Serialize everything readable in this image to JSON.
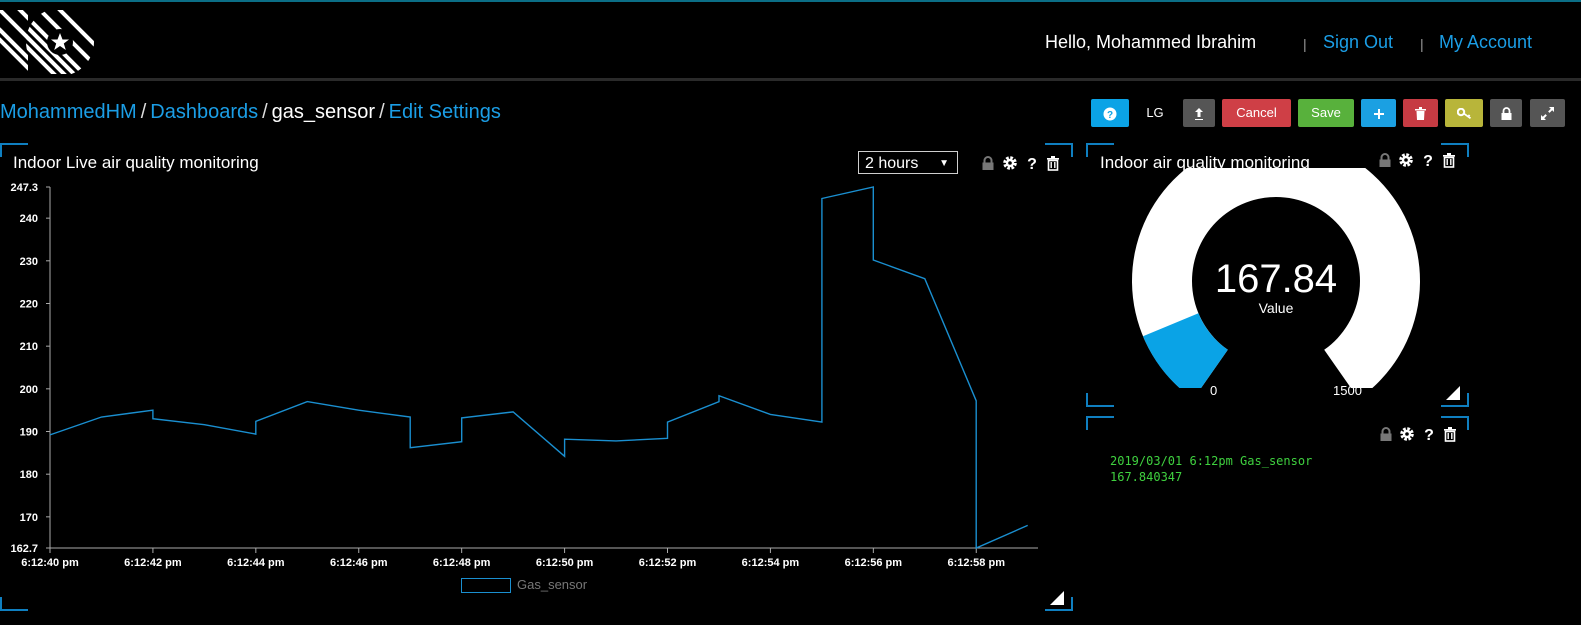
{
  "header": {
    "greeting": "Hello, Mohammed Ibrahim",
    "sign_out": "Sign Out",
    "my_account": "My Account",
    "separator": "|"
  },
  "breadcrumb": {
    "user": "MohammedHM",
    "dashboards": "Dashboards",
    "current": "gas_sensor",
    "edit": "Edit Settings",
    "slash": "/"
  },
  "toolbar": {
    "help_icon": "question-icon",
    "lg_label": "LG",
    "share_icon": "share-icon",
    "cancel_label": "Cancel",
    "save_label": "Save",
    "add_icon": "plus-icon",
    "delete_icon": "trash-icon",
    "key_icon": "key-icon",
    "lock_icon": "lock-icon",
    "expand_icon": "expand-icon",
    "colors": {
      "help": "#0ba3e6",
      "share": "#555555",
      "cancel": "#cf3f46",
      "save": "#58b13c",
      "add": "#1ba0e2",
      "delete": "#c63b43",
      "key": "#b8b53a",
      "lock": "#555555",
      "expand": "#555555"
    }
  },
  "line_panel": {
    "title": "Indoor Live air quality monitoring",
    "range_select": "2 hours",
    "controls": [
      "lock-icon",
      "gear-icon",
      "question-icon",
      "trash-icon"
    ]
  },
  "gauge_panel": {
    "title": "Indoor air quality monitoring",
    "value": "167.84",
    "value_label": "Value",
    "min": "0",
    "max": "1500",
    "level": 167.84,
    "colors": {
      "fill": "#0aa3e6",
      "track": "#ffffff"
    }
  },
  "log_panel": {
    "line1": "2019/03/01 6:12pm  Gas_sensor",
    "line2": "167.840347"
  },
  "chart_data": {
    "type": "line",
    "title": "",
    "xlabel": "",
    "ylabel": "",
    "ylim": [
      162.7,
      247.3
    ],
    "y_ticks": [
      "247.3",
      "240",
      "230",
      "220",
      "210",
      "200",
      "190",
      "180",
      "170",
      "162.7"
    ],
    "x_ticks": [
      "6:12:40 pm",
      "6:12:42 pm",
      "6:12:44 pm",
      "6:12:46 pm",
      "6:12:48 pm",
      "6:12:50 pm",
      "6:12:52 pm",
      "6:12:54 pm",
      "6:12:56 pm",
      "6:12:58 pm"
    ],
    "x_range": [
      "6:12:40 pm",
      "6:12:59.2 pm"
    ],
    "grid": false,
    "legend": "bottom",
    "series": [
      {
        "name": "Gas_sensor",
        "color": "#1a8fd0",
        "points": [
          {
            "x": "6:12:40.0 pm",
            "y": 189.2
          },
          {
            "x": "6:12:41.0 pm",
            "y": 193.4
          },
          {
            "x": "6:12:42.0 pm",
            "y": 195.0
          },
          {
            "x": "6:12:42.0 pm",
            "y": 193.0
          },
          {
            "x": "6:12:43.0 pm",
            "y": 191.6
          },
          {
            "x": "6:12:44.0 pm",
            "y": 189.4
          },
          {
            "x": "6:12:44.0 pm",
            "y": 192.4
          },
          {
            "x": "6:12:45.0 pm",
            "y": 197.0
          },
          {
            "x": "6:12:46.0 pm",
            "y": 195.0
          },
          {
            "x": "6:12:47.0 pm",
            "y": 193.4
          },
          {
            "x": "6:12:47.0 pm",
            "y": 186.2
          },
          {
            "x": "6:12:48.0 pm",
            "y": 187.6
          },
          {
            "x": "6:12:48.0 pm",
            "y": 193.2
          },
          {
            "x": "6:12:49.0 pm",
            "y": 194.6
          },
          {
            "x": "6:12:50.0 pm",
            "y": 184.2
          },
          {
            "x": "6:12:50.0 pm",
            "y": 188.2
          },
          {
            "x": "6:12:51.0 pm",
            "y": 187.8
          },
          {
            "x": "6:12:52.0 pm",
            "y": 188.4
          },
          {
            "x": "6:12:52.0 pm",
            "y": 192.2
          },
          {
            "x": "6:12:53.0 pm",
            "y": 197.0
          },
          {
            "x": "6:12:53.0 pm",
            "y": 198.4
          },
          {
            "x": "6:12:54.0 pm",
            "y": 194.0
          },
          {
            "x": "6:12:55.0 pm",
            "y": 192.2
          },
          {
            "x": "6:12:55.0 pm",
            "y": 244.6
          },
          {
            "x": "6:12:56.0 pm",
            "y": 247.3
          },
          {
            "x": "6:12:56.0 pm",
            "y": 230.2
          },
          {
            "x": "6:12:57.0 pm",
            "y": 225.8
          },
          {
            "x": "6:12:58.0 pm",
            "y": 197.2
          },
          {
            "x": "6:12:58.0 pm",
            "y": 162.7
          },
          {
            "x": "6:12:59.0 pm",
            "y": 168.0
          }
        ]
      }
    ]
  }
}
